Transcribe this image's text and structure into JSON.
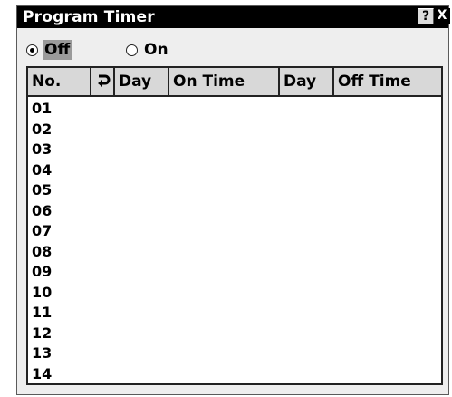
{
  "window": {
    "title": "Program Timer",
    "help_label": "?",
    "close_label": "X"
  },
  "mode": {
    "options": [
      {
        "label": "Off",
        "selected": true
      },
      {
        "label": "On",
        "selected": false
      }
    ]
  },
  "table": {
    "columns": {
      "no": "No.",
      "repeat_icon": "repeat-icon",
      "day1": "Day",
      "on_time": "On Time",
      "day2": "Day",
      "off_time": "Off Time"
    },
    "rows": [
      "01",
      "02",
      "03",
      "04",
      "05",
      "06",
      "07",
      "08",
      "09",
      "10",
      "11",
      "12",
      "13",
      "14"
    ]
  }
}
